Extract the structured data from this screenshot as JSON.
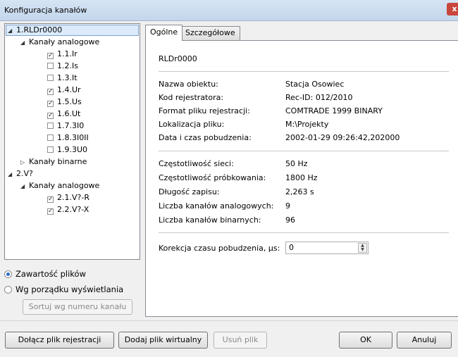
{
  "window": {
    "title": "Konfiguracja kanałów",
    "close_glyph": "x"
  },
  "tree": {
    "items": [
      {
        "label": "1.RLDr0000",
        "level": 0,
        "expanded": true,
        "selected": true
      },
      {
        "label": "Kanały analogowe",
        "level": 1,
        "expanded": true
      },
      {
        "label": "1.1.Ir",
        "level": 2,
        "checked": true
      },
      {
        "label": "1.2.Is",
        "level": 2,
        "checked": false
      },
      {
        "label": "1.3.It",
        "level": 2,
        "checked": false
      },
      {
        "label": "1.4.Ur",
        "level": 2,
        "checked": true
      },
      {
        "label": "1.5.Us",
        "level": 2,
        "checked": true
      },
      {
        "label": "1.6.Ut",
        "level": 2,
        "checked": true
      },
      {
        "label": "1.7.3I0",
        "level": 2,
        "checked": false
      },
      {
        "label": "1.8.3I0II",
        "level": 2,
        "checked": false
      },
      {
        "label": "1.9.3U0",
        "level": 2,
        "checked": false
      },
      {
        "label": "Kanały binarne",
        "level": 1,
        "expanded": false
      },
      {
        "label": "2.V?",
        "level": 0,
        "expanded": true
      },
      {
        "label": "Kanały analogowe",
        "level": 1,
        "expanded": true
      },
      {
        "label": "2.1.V?-R",
        "level": 2,
        "checked": true
      },
      {
        "label": "2.2.V?-X",
        "level": 2,
        "checked": true
      }
    ]
  },
  "sort_mode": {
    "options": [
      {
        "label": "Zawartość plików",
        "selected": true
      },
      {
        "label": "Wg porządku wyświetlania",
        "selected": false
      }
    ],
    "sort_button": "Sortuj wg numeru kanału"
  },
  "tabs": [
    {
      "label": "Ogólne",
      "active": true
    },
    {
      "label": "Szczegółowe",
      "active": false
    }
  ],
  "general": {
    "heading": "RLDr0000",
    "group1": [
      {
        "label": "Nazwa obiektu:",
        "value": "Stacja Osowiec"
      },
      {
        "label": "Kod rejestratora:",
        "value": "Rec-ID: 012/2010"
      },
      {
        "label": "Format pliku rejestracji:",
        "value": "COMTRADE 1999 BINARY"
      },
      {
        "label": "Lokalizacja pliku:",
        "value": "M:\\Projekty"
      },
      {
        "label": "Data i czas pobudzenia:",
        "value": "2002-01-29 09:26:42,202000"
      }
    ],
    "group2": [
      {
        "label": "Częstotliwość sieci:",
        "value": "50 Hz"
      },
      {
        "label": "Częstotliwość próbkowania:",
        "value": "1800 Hz"
      },
      {
        "label": "Długość zapisu:",
        "value": "2,263 s"
      },
      {
        "label": "Liczba kanałów analogowych:",
        "value": "9"
      },
      {
        "label": "Liczba kanałów binarnych:",
        "value": "96"
      }
    ],
    "correction": {
      "label": "Korekcja czasu pobudzenia, µs:",
      "value": "0"
    }
  },
  "buttons": {
    "attach": "Dołącz plik rejestracji",
    "add_virtual": "Dodaj plik wirtualny",
    "remove": "Usuń plik",
    "ok": "OK",
    "cancel": "Anuluj"
  }
}
